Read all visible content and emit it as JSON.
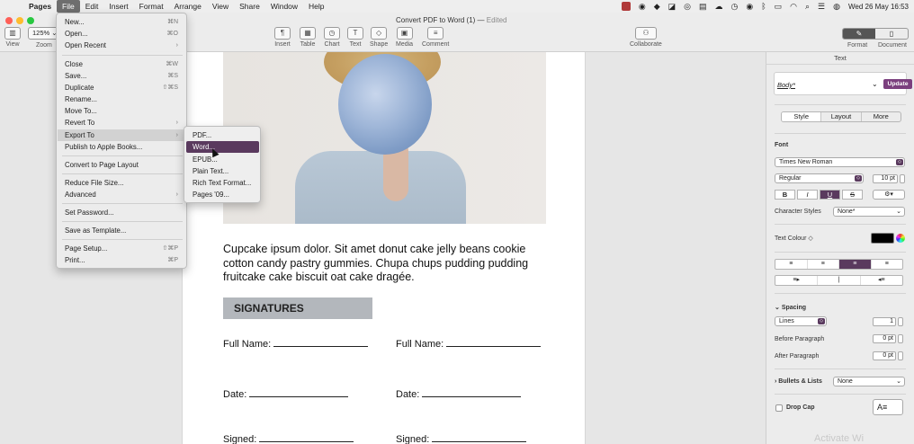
{
  "menubar": {
    "app": "Pages",
    "items": [
      "File",
      "Edit",
      "Insert",
      "Format",
      "Arrange",
      "View",
      "Share",
      "Window",
      "Help"
    ],
    "clock": "Wed 26 May  16:53"
  },
  "window": {
    "title": "Convert PDF to Word (1)",
    "title_sep": " — ",
    "edited": "Edited"
  },
  "toolbar": {
    "view_label": "View",
    "zoom_label": "Zoom",
    "zoom_value": "125%",
    "tools": [
      {
        "label": "Insert",
        "glyph": "¶"
      },
      {
        "label": "Table",
        "glyph": "▦"
      },
      {
        "label": "Chart",
        "glyph": "◷"
      },
      {
        "label": "Text",
        "glyph": "T"
      },
      {
        "label": "Shape",
        "glyph": "◇"
      },
      {
        "label": "Media",
        "glyph": "▣"
      },
      {
        "label": "Comment",
        "glyph": "≡"
      }
    ],
    "collaborate_label": "Collaborate",
    "format_label": "Format",
    "document_label": "Document"
  },
  "file_menu": {
    "items": [
      {
        "label": "New...",
        "shortcut": "⌘N"
      },
      {
        "label": "Open...",
        "shortcut": "⌘O"
      },
      {
        "label": "Open Recent",
        "shortcut": "›"
      },
      {
        "label": "Close",
        "shortcut": "⌘W"
      },
      {
        "label": "Save...",
        "shortcut": "⌘S"
      },
      {
        "label": "Duplicate",
        "shortcut": "⇧⌘S"
      },
      {
        "label": "Rename...",
        "shortcut": ""
      },
      {
        "label": "Move To...",
        "shortcut": ""
      },
      {
        "label": "Revert To",
        "shortcut": "›"
      },
      {
        "label": "Export To",
        "shortcut": "›"
      },
      {
        "label": "Publish to Apple Books...",
        "shortcut": ""
      },
      {
        "label": "Convert to Page Layout",
        "shortcut": ""
      },
      {
        "label": "Reduce File Size...",
        "shortcut": ""
      },
      {
        "label": "Advanced",
        "shortcut": "›"
      },
      {
        "label": "Set Password...",
        "shortcut": ""
      },
      {
        "label": "Save as Template...",
        "shortcut": ""
      },
      {
        "label": "Page Setup...",
        "shortcut": "⇧⌘P"
      },
      {
        "label": "Print...",
        "shortcut": "⌘P"
      }
    ]
  },
  "export_menu": {
    "items": [
      "PDF...",
      "Word...",
      "EPUB...",
      "Plain Text...",
      "Rich Text Format...",
      "Pages '09..."
    ]
  },
  "document": {
    "paragraph": "Cupcake ipsum dolor. Sit amet donut cake jelly beans cookie cotton candy pastry gummies. Chupa chups pudding pudding fruitcake cake biscuit oat cake dragée.",
    "signatures_heading": "SIGNATURES",
    "full_name_label": "Full Name:",
    "date_label": "Date:",
    "signed_label": "Signed:"
  },
  "inspector": {
    "tab_title": "Text",
    "paragraph_style": "Body*",
    "update_label": "Update",
    "sub_tabs": [
      "Style",
      "Layout",
      "More"
    ],
    "font_heading": "Font",
    "font_family": "Times New Roman",
    "font_style": "Regular",
    "font_size": "10 pt",
    "bius": [
      "B",
      "I",
      "U",
      "S"
    ],
    "gear_glyph": "⚙▾",
    "character_styles_label": "Character Styles",
    "character_styles_value": "None*",
    "text_colour_label": "Text Colour ◇",
    "align_glyphs": [
      "≡",
      "≡",
      "≡",
      "≡"
    ],
    "indent_glyphs": [
      "≡▸",
      "|",
      "◂≡"
    ],
    "spacing_label": "Spacing",
    "spacing_value": "Lines",
    "line_value": "1",
    "before_paragraph_label": "Before Paragraph",
    "before_paragraph_value": "0 pt",
    "after_paragraph_label": "After Paragraph",
    "after_paragraph_value": "0 pt",
    "bullets_label": "Bullets & Lists",
    "bullets_value": "None",
    "drop_cap_label": "Drop Cap",
    "drop_cap_glyph": "A≡"
  },
  "watermark": "Activate Wi"
}
